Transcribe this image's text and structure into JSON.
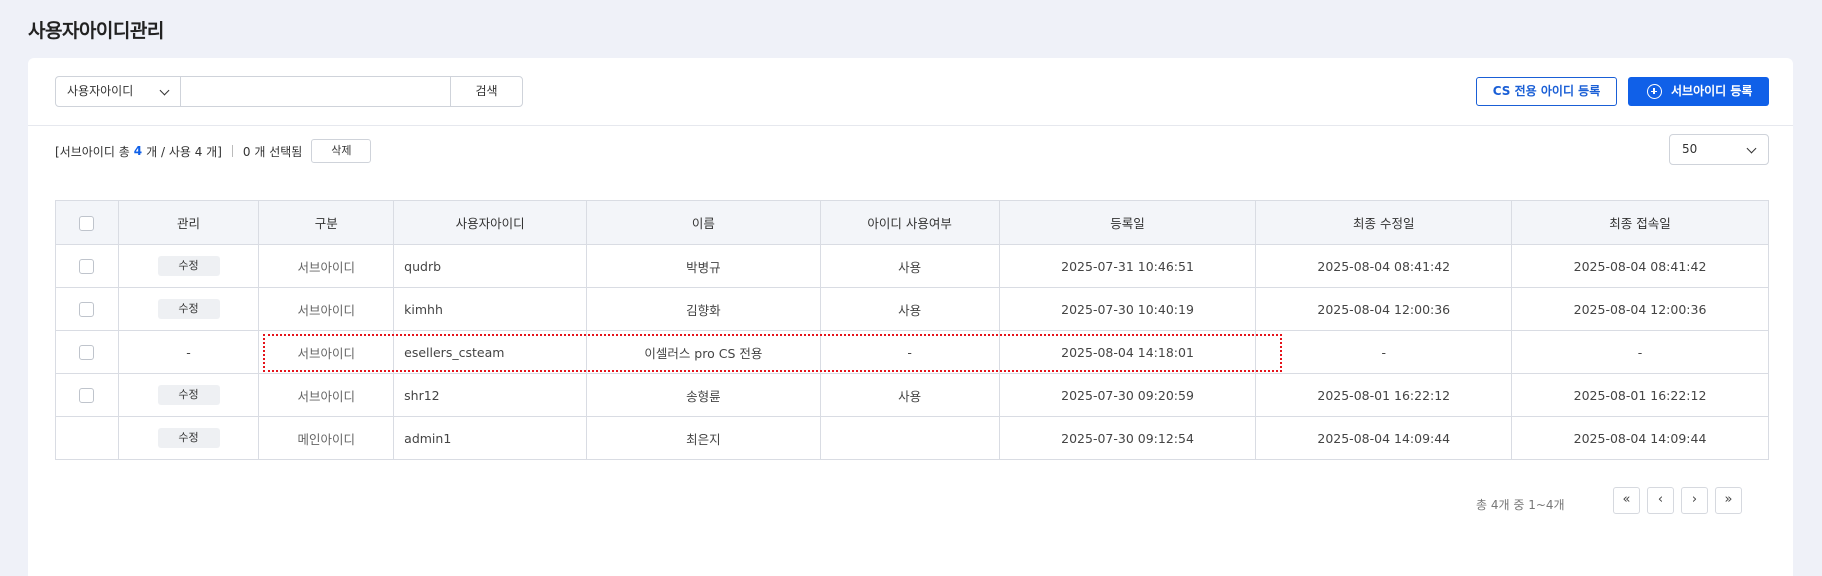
{
  "page": {
    "title": "사용자아이디관리"
  },
  "search": {
    "select_value": "사용자아이디",
    "input_value": "",
    "button_label": "검색"
  },
  "actions": {
    "cs_register_label": "CS 전용 아이디 등록",
    "sub_register_label": "서브아이디 등록"
  },
  "summary": {
    "prefix": "[서브아이디 총",
    "total": "4",
    "middle": "개 / 사용 4 개]",
    "selected": "0 개 선택됨",
    "delete_label": "삭제"
  },
  "page_size": "50",
  "table": {
    "headers": [
      "관리",
      "구분",
      "사용자아이디",
      "이름",
      "아이디 사용여부",
      "등록일",
      "최종 수정일",
      "최종 접속일"
    ],
    "rows": [
      {
        "checkbox": true,
        "manage": "수정",
        "type": "서브아이디",
        "user_id": "qudrb",
        "name": "박병규",
        "status": "사용",
        "registered": "2025-07-31 10:46:51",
        "modified": "2025-08-04 08:41:42",
        "accessed": "2025-08-04 08:41:42"
      },
      {
        "checkbox": true,
        "manage": "수정",
        "type": "서브아이디",
        "user_id": "kimhh",
        "name": "김향화",
        "status": "사용",
        "registered": "2025-07-30 10:40:19",
        "modified": "2025-08-04 12:00:36",
        "accessed": "2025-08-04 12:00:36"
      },
      {
        "checkbox": true,
        "manage": "-",
        "type": "서브아이디",
        "user_id": "esellers_csteam",
        "name": "이셀러스 pro CS 전용",
        "status": "-",
        "registered": "2025-08-04 14:18:01",
        "modified": "-",
        "accessed": "-"
      },
      {
        "checkbox": true,
        "manage": "수정",
        "type": "서브아이디",
        "user_id": "shr12",
        "name": "송형륜",
        "status": "사용",
        "registered": "2025-07-30 09:20:59",
        "modified": "2025-08-01 16:22:12",
        "accessed": "2025-08-01 16:22:12"
      },
      {
        "checkbox": false,
        "manage": "수정",
        "type": "메인아이디",
        "user_id": "admin1",
        "name": "최은지",
        "status": "",
        "registered": "2025-07-30 09:12:54",
        "modified": "2025-08-04 14:09:44",
        "accessed": "2025-08-04 14:09:44"
      }
    ]
  },
  "pagination": {
    "info": "총 4개 중 1~4개",
    "first": "«",
    "prev": "‹",
    "next": "›",
    "last": "»"
  },
  "colors": {
    "primary": "#1060e8",
    "highlight": "#e5131b"
  }
}
